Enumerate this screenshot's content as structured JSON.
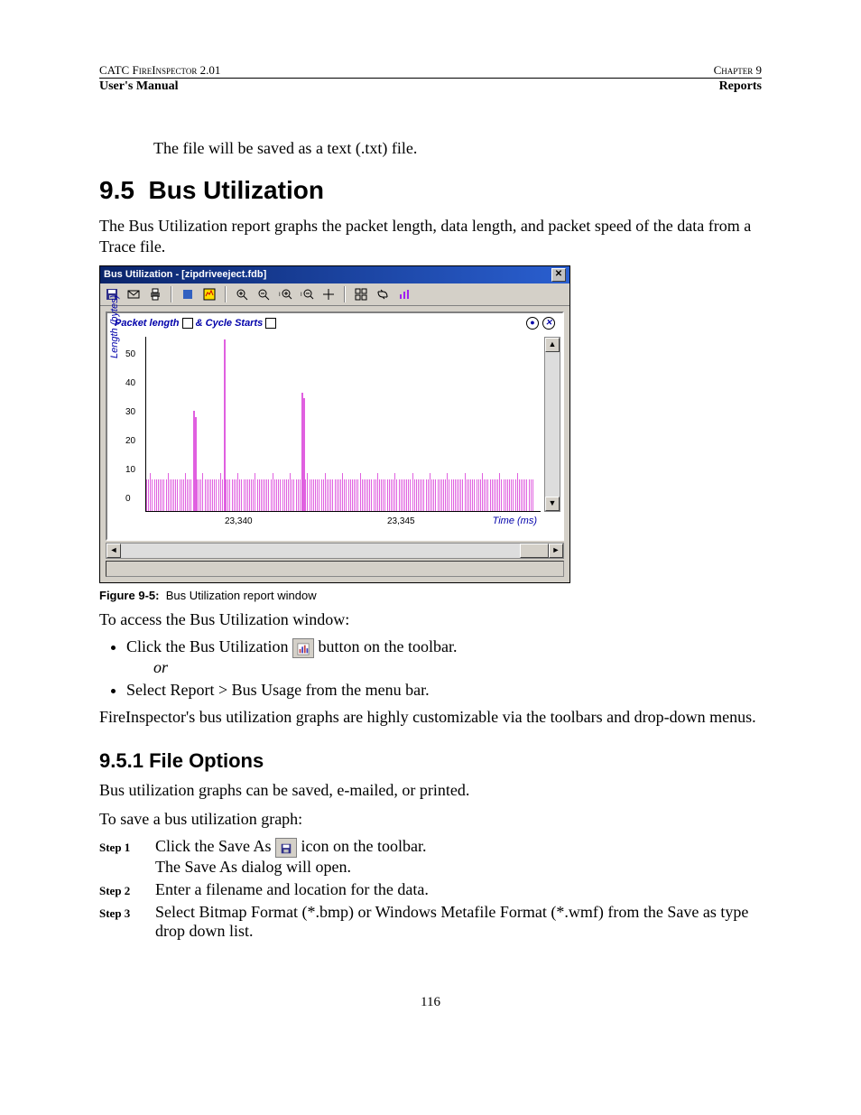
{
  "header": {
    "left_top": "CATC FireInspector 2.01",
    "right_top": "Chapter 9",
    "left_bottom": "User's Manual",
    "right_bottom": "Reports"
  },
  "intro_line": "The file will be saved as a text (.txt) file.",
  "section": {
    "number": "9.5",
    "title": "Bus Utilization",
    "para": "The Bus Utilization report graphs the packet length, data length, and packet speed of the data from a Trace file."
  },
  "figure": {
    "window_title": "Bus Utilization - [zipdriveeject.fdb]",
    "graph_title_1": "Packet length",
    "graph_title_2": "& Cycle Starts",
    "ylabel": "Length (bytes)",
    "xlabel": "Time (ms)",
    "yticks": [
      "50",
      "40",
      "30",
      "20",
      "10",
      "0"
    ],
    "xticks": [
      "23,340",
      "23,345"
    ],
    "caption_label": "Figure 9-5:",
    "caption_text": "Bus Utilization report window"
  },
  "chart_data": {
    "type": "bar",
    "title": "Packet length & Cycle Starts",
    "xlabel": "Time (ms)",
    "ylabel": "Length (bytes)",
    "ylim": [
      0,
      55
    ],
    "x_range": [
      23338,
      23348
    ],
    "xticks": [
      23340,
      23345
    ],
    "yticks": [
      0,
      10,
      20,
      30,
      40,
      50
    ],
    "baseline_values_approx": 10,
    "spikes": [
      {
        "x": 23339.2,
        "y": 32
      },
      {
        "x": 23339.25,
        "y": 30
      },
      {
        "x": 23340.0,
        "y": 55
      },
      {
        "x": 23342.0,
        "y": 38
      },
      {
        "x": 23342.05,
        "y": 36
      }
    ],
    "note": "Dense bars approx height 10 across range with a few taller spikes as listed"
  },
  "access": {
    "heading": "To access the Bus Utilization window:",
    "bullet1_pre": "Click the Bus Utilization",
    "bullet1_post": "button on the toolbar.",
    "or": "or",
    "bullet2": "Select Report > Bus Usage from the menu bar.",
    "para2": "FireInspector's bus utilization graphs are highly customizable via the toolbars and drop-down menus."
  },
  "subsection": {
    "number": "9.5.1",
    "title": "File Options",
    "p1": "Bus utilization graphs can be saved, e-mailed, or printed.",
    "p2": "To save a bus utilization graph:",
    "steps": [
      {
        "label": "Step 1",
        "pre": "Click the Save As",
        "post": "icon on the toolbar.",
        "line2": "The Save As dialog will open."
      },
      {
        "label": "Step 2",
        "text": "Enter a filename and location for the data."
      },
      {
        "label": "Step 3",
        "text": "Select Bitmap Format (*.bmp) or Windows Metafile Format (*.wmf) from the Save as type drop down list."
      }
    ]
  },
  "pagenum": "116"
}
